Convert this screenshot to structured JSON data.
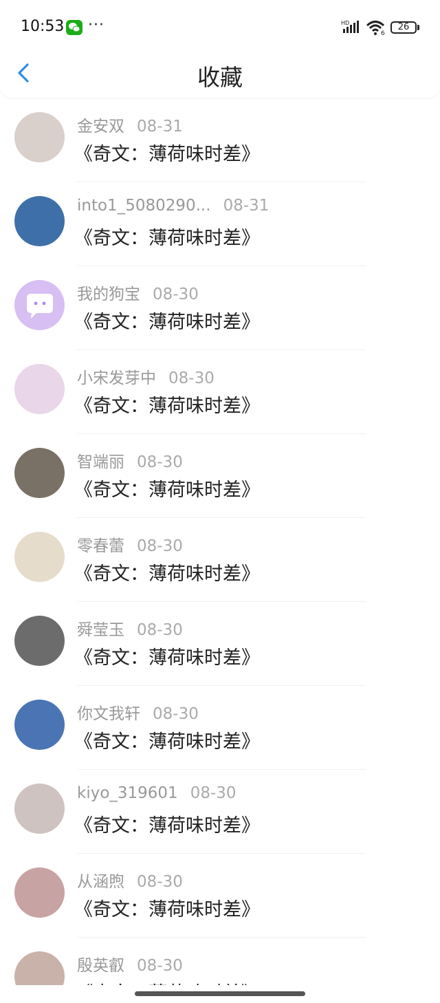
{
  "status_bar": {
    "time": "10:53",
    "dots": "···",
    "signal_label": "HD",
    "wifi_label": "6",
    "battery": "26"
  },
  "header": {
    "title": "收藏"
  },
  "items": [
    {
      "name": "金安双",
      "date": "08-31",
      "title": "《奇文：薄荷味时差》",
      "avatar_color": "#d9cfcb"
    },
    {
      "name": "into1_5080290...",
      "date": "08-31",
      "title": "《奇文：薄荷味时差》",
      "avatar_color": "#3f6fa8"
    },
    {
      "name": "我的狗宝",
      "date": "08-30",
      "title": "《奇文：薄荷味时差》",
      "avatar_color": "#d7bff3"
    },
    {
      "name": "小宋发芽中",
      "date": "08-30",
      "title": "《奇文：薄荷味时差》",
      "avatar_color": "#e9d6e8"
    },
    {
      "name": "智端丽",
      "date": "08-30",
      "title": "《奇文：薄荷味时差》",
      "avatar_color": "#7a7166"
    },
    {
      "name": "零春蕾",
      "date": "08-30",
      "title": "《奇文：薄荷味时差》",
      "avatar_color": "#e6dccb"
    },
    {
      "name": "舜莹玉",
      "date": "08-30",
      "title": "《奇文：薄荷味时差》",
      "avatar_color": "#6c6c6c"
    },
    {
      "name": "你文我轩",
      "date": "08-30",
      "title": "《奇文：薄荷味时差》",
      "avatar_color": "#4a74b3"
    },
    {
      "name": "kiyo_319601",
      "date": "08-30",
      "title": "《奇文：薄荷味时差》",
      "avatar_color": "#cfc3c1"
    },
    {
      "name": "从涵煦",
      "date": "08-30",
      "title": "《奇文：薄荷味时差》",
      "avatar_color": "#c8a3a4"
    },
    {
      "name": "殷英叡",
      "date": "08-30",
      "title": "《奇文：薄荷味时差》",
      "avatar_color": "#c9b2aa"
    }
  ]
}
